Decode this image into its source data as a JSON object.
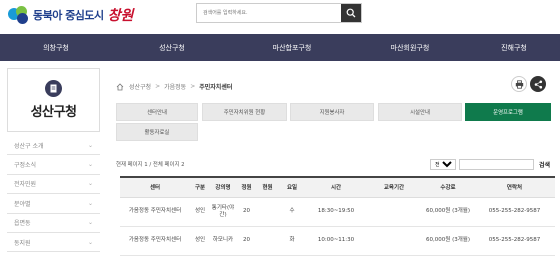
{
  "header": {
    "logo_text": "동북아 중심도시",
    "logo_city": "창원",
    "search_placeholder": "검색어를 입력하세요."
  },
  "nav": [
    "의창구청",
    "성산구청",
    "마산합포구청",
    "마산회원구청",
    "진해구청"
  ],
  "sidebar": {
    "title": "성산구청",
    "items": [
      {
        "label": "성산구 소개"
      },
      {
        "label": "구정소식"
      },
      {
        "label": "전자민원"
      },
      {
        "label": "분야별"
      },
      {
        "label": "읍면동"
      },
      {
        "label": "동지원"
      }
    ]
  },
  "breadcrumb": [
    "성산구청",
    "가음정동",
    "주민자치센터"
  ],
  "tabs": [
    {
      "label": "센터안내"
    },
    {
      "label": "주민자치위원 현황"
    },
    {
      "label": "지원봉사자"
    },
    {
      "label": "시설안내"
    },
    {
      "label": "운영프로그램"
    },
    {
      "label": "활동자료실"
    }
  ],
  "page_info": "현재 페이지 1 / 전체 페이지 2",
  "filter": {
    "select": "전체",
    "button": "검색"
  },
  "table": {
    "headers": [
      "센터",
      "구분",
      "강의명",
      "정원",
      "현원",
      "요일",
      "시간",
      "교육기간",
      "수강료",
      "연락처"
    ],
    "rows": [
      [
        "가음정동 주민자치센터",
        "성인",
        "통기타(야간)",
        "20",
        "",
        "수",
        "18:30~19:50",
        "",
        "60,000원 (3개월)",
        "055-255-282-9587"
      ],
      [
        "가음정동 주민자치센터",
        "성인",
        "하모니카",
        "20",
        "",
        "화",
        "10:00~11:30",
        "",
        "60,000원 (3개월)",
        "055-255-282-9587"
      ]
    ]
  }
}
